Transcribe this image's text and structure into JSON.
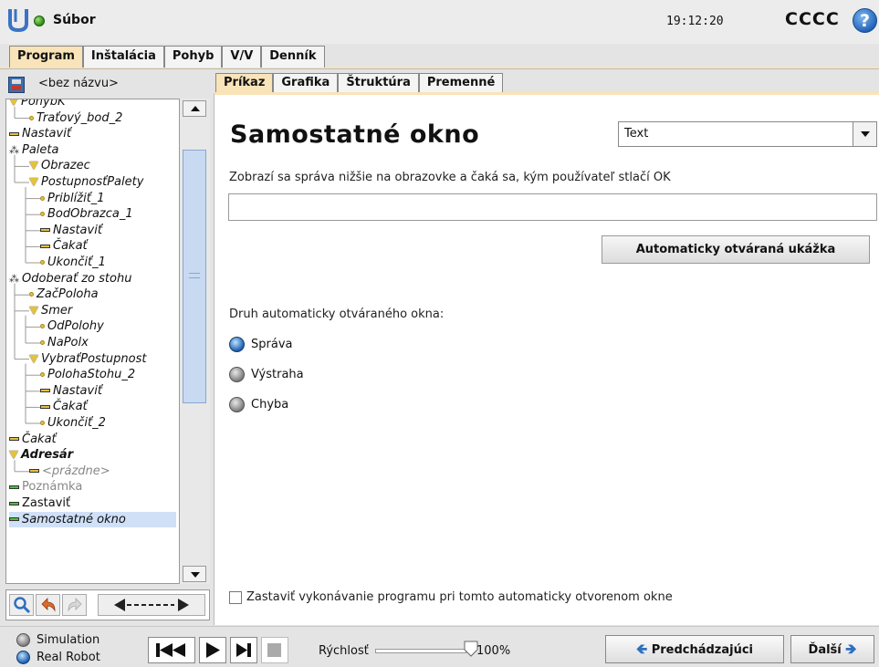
{
  "header": {
    "file_menu": "Súbor",
    "clock": "19:12:20",
    "robot_name": "CCCC",
    "help": "?"
  },
  "main_tabs": [
    {
      "label": "Program",
      "active": true
    },
    {
      "label": "Inštalácia",
      "active": false
    },
    {
      "label": "Pohyb",
      "active": false
    },
    {
      "label": "V/V",
      "active": false
    },
    {
      "label": "Denník",
      "active": false
    }
  ],
  "program": {
    "name": "<bez názvu>"
  },
  "tree": [
    {
      "label": "PohybK",
      "icon": "triangle",
      "indent": 0,
      "style": "italic"
    },
    {
      "label": "Traťový_bod_2",
      "icon": "dot",
      "indent": 1,
      "style": "italic"
    },
    {
      "label": "Nastaviť",
      "icon": "bar",
      "indent": 0,
      "style": "italic"
    },
    {
      "label": "Paleta",
      "icon": "pallet",
      "indent": 0,
      "style": "italic"
    },
    {
      "label": "Obrazec",
      "icon": "triangle",
      "indent": 1,
      "style": "italic"
    },
    {
      "label": "PostupnosťPalety",
      "icon": "triangle",
      "indent": 1,
      "style": "italic"
    },
    {
      "label": "Priblížiť_1",
      "icon": "dot",
      "indent": 2,
      "style": "italic"
    },
    {
      "label": "BodObrazca_1",
      "icon": "dot",
      "indent": 2,
      "style": "italic"
    },
    {
      "label": "Nastaviť",
      "icon": "bar",
      "indent": 2,
      "style": "italic"
    },
    {
      "label": "Čakať",
      "icon": "bar",
      "indent": 2,
      "style": "italic"
    },
    {
      "label": "Ukončiť_1",
      "icon": "dot",
      "indent": 2,
      "style": "italic"
    },
    {
      "label": "Odoberať zo stohu",
      "icon": "pallet",
      "indent": 0,
      "style": "italic"
    },
    {
      "label": "ZačPoloha",
      "icon": "dot",
      "indent": 1,
      "style": "italic"
    },
    {
      "label": "Smer",
      "icon": "triangle",
      "indent": 1,
      "style": "italic"
    },
    {
      "label": "OdPolohy",
      "icon": "dot",
      "indent": 2,
      "style": "italic"
    },
    {
      "label": "NaPolx",
      "icon": "dot",
      "indent": 2,
      "style": "italic"
    },
    {
      "label": "VybraťPostupnost",
      "icon": "triangle",
      "indent": 1,
      "style": "italic"
    },
    {
      "label": "PolohaStohu_2",
      "icon": "dot",
      "indent": 2,
      "style": "italic"
    },
    {
      "label": "Nastaviť",
      "icon": "bar",
      "indent": 2,
      "style": "italic"
    },
    {
      "label": "Čakať",
      "icon": "bar",
      "indent": 2,
      "style": "italic"
    },
    {
      "label": "Ukončiť_2",
      "icon": "dot",
      "indent": 2,
      "style": "italic"
    },
    {
      "label": "Čakať",
      "icon": "bar",
      "indent": 0,
      "style": "italic"
    },
    {
      "label": "Adresár",
      "icon": "triangle",
      "indent": 0,
      "style": "bold"
    },
    {
      "label": "<prázdne>",
      "icon": "bar",
      "indent": 1,
      "style": "gray-italic"
    },
    {
      "label": "Poznámka",
      "icon": "bar-green",
      "indent": 0,
      "style": "gray"
    },
    {
      "label": "Zastaviť",
      "icon": "bar-green",
      "indent": 0,
      "style": "normal"
    },
    {
      "label": "Samostatné okno",
      "icon": "bar-green",
      "indent": 0,
      "style": "selected"
    }
  ],
  "sub_tabs": [
    {
      "label": "Príkaz",
      "active": true
    },
    {
      "label": "Grafika",
      "active": false
    },
    {
      "label": "Štruktúra",
      "active": false
    },
    {
      "label": "Premenné",
      "active": false
    }
  ],
  "content": {
    "title": "Samostatné okno",
    "dropdown_value": "Text",
    "description": "Zobrazí sa správa nižšie na obrazovke a čaká sa, kým používateľ stlačí OK",
    "message_value": "",
    "preview_button": "Automaticky otváraná ukážka",
    "type_label": "Druh automaticky otváraného okna:",
    "types": [
      {
        "label": "Správa",
        "selected": true
      },
      {
        "label": "Výstraha",
        "selected": false
      },
      {
        "label": "Chyba",
        "selected": false
      }
    ],
    "stop_label": "Zastaviť vykonávanie programu pri tomto automaticky otvorenom okne",
    "stop_checked": false
  },
  "footer": {
    "modes": [
      {
        "label": "Simulation",
        "selected": false
      },
      {
        "label": "Real Robot",
        "selected": true
      }
    ],
    "speed_label": "Rýchlosť",
    "speed_value": "100%",
    "speed_fraction": 1.0,
    "prev_button": "Predchádzajúci",
    "next_button": "Ďalší"
  },
  "colors": {
    "tab_active": "#f9e3b9",
    "selection": "#cfe0f7",
    "accent_blue": "#2f6fbf"
  }
}
